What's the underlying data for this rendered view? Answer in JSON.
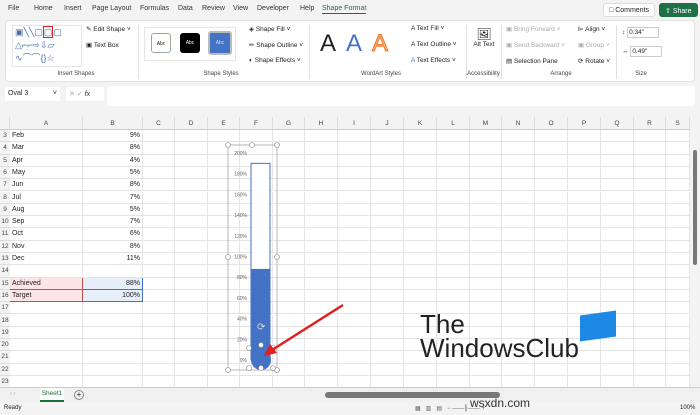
{
  "ribbon_tabs": [
    "File",
    "Home",
    "Insert",
    "Page Layout",
    "Formulas",
    "Data",
    "Review",
    "View",
    "Developer",
    "Help",
    "Shape Format"
  ],
  "active_tab": "Shape Format",
  "comments_label": "Comments",
  "share_label": "Share",
  "insert_shapes": {
    "edit_shape": "Edit Shape",
    "text_box": "Text Box",
    "label": "Insert Shapes"
  },
  "shape_styles": {
    "abc": "Abc",
    "fill": "Shape Fill",
    "outline": "Shape Outline",
    "effects": "Shape Effects",
    "label": "Shape Styles"
  },
  "wordart": {
    "letter": "A",
    "fill": "Text Fill",
    "outline": "Text Outline",
    "effects": "Text Effects",
    "label": "WordArt Styles"
  },
  "accessibility": {
    "alt_text": "Alt Text",
    "label": "Accessibility"
  },
  "arrange": {
    "bring_forward": "Bring Forward",
    "send_backward": "Send Backward",
    "selection_pane": "Selection Pane",
    "align": "Align",
    "group": "Group",
    "rotate": "Rotate",
    "label": "Arrange"
  },
  "size": {
    "height": "0.34\"",
    "width": "0.49\"",
    "label": "Size"
  },
  "name_box": "Oval 3",
  "fx": "fx",
  "columns": [
    "A",
    "B",
    "C",
    "D",
    "E",
    "F",
    "G",
    "H",
    "I",
    "J",
    "K",
    "L",
    "M",
    "N",
    "O",
    "P",
    "Q",
    "R",
    "S"
  ],
  "rows": [
    {
      "n": "3",
      "a": "Feb",
      "b": "9%"
    },
    {
      "n": "4",
      "a": "Mar",
      "b": "8%"
    },
    {
      "n": "5",
      "a": "Apr",
      "b": "4%"
    },
    {
      "n": "6",
      "a": "May",
      "b": "5%"
    },
    {
      "n": "7",
      "a": "Jun",
      "b": "8%"
    },
    {
      "n": "8",
      "a": "Jul",
      "b": "7%"
    },
    {
      "n": "9",
      "a": "Aug",
      "b": "5%"
    },
    {
      "n": "10",
      "a": "Sep",
      "b": "7%"
    },
    {
      "n": "11",
      "a": "Oct",
      "b": "6%"
    },
    {
      "n": "12",
      "a": "Nov",
      "b": "8%"
    },
    {
      "n": "13",
      "a": "Dec",
      "b": "11%"
    },
    {
      "n": "14",
      "a": "",
      "b": ""
    },
    {
      "n": "15",
      "a": "Achieved",
      "b": "88%"
    },
    {
      "n": "16",
      "a": "Target",
      "b": "100%"
    },
    {
      "n": "17",
      "a": "",
      "b": ""
    },
    {
      "n": "18",
      "a": "",
      "b": ""
    },
    {
      "n": "19",
      "a": "",
      "b": ""
    },
    {
      "n": "20",
      "a": "",
      "b": ""
    },
    {
      "n": "21",
      "a": "",
      "b": ""
    },
    {
      "n": "22",
      "a": "",
      "b": ""
    },
    {
      "n": "23",
      "a": "",
      "b": ""
    }
  ],
  "chart": {
    "axis_labels": [
      "200%",
      "180%",
      "160%",
      "140%",
      "120%",
      "100%",
      "80%",
      "60%",
      "40%",
      "20%",
      "0%"
    ],
    "achieved": 0.88,
    "max": 2.0,
    "bar_top": 1.9,
    "fill_color": "#4472c4"
  },
  "sheet_tab": "Sheet1",
  "status": {
    "ready": "Ready",
    "zoom": "100%"
  },
  "watermark": {
    "line1": "The",
    "line2": "WindowsClub",
    "site": "wsxdn.com"
  }
}
